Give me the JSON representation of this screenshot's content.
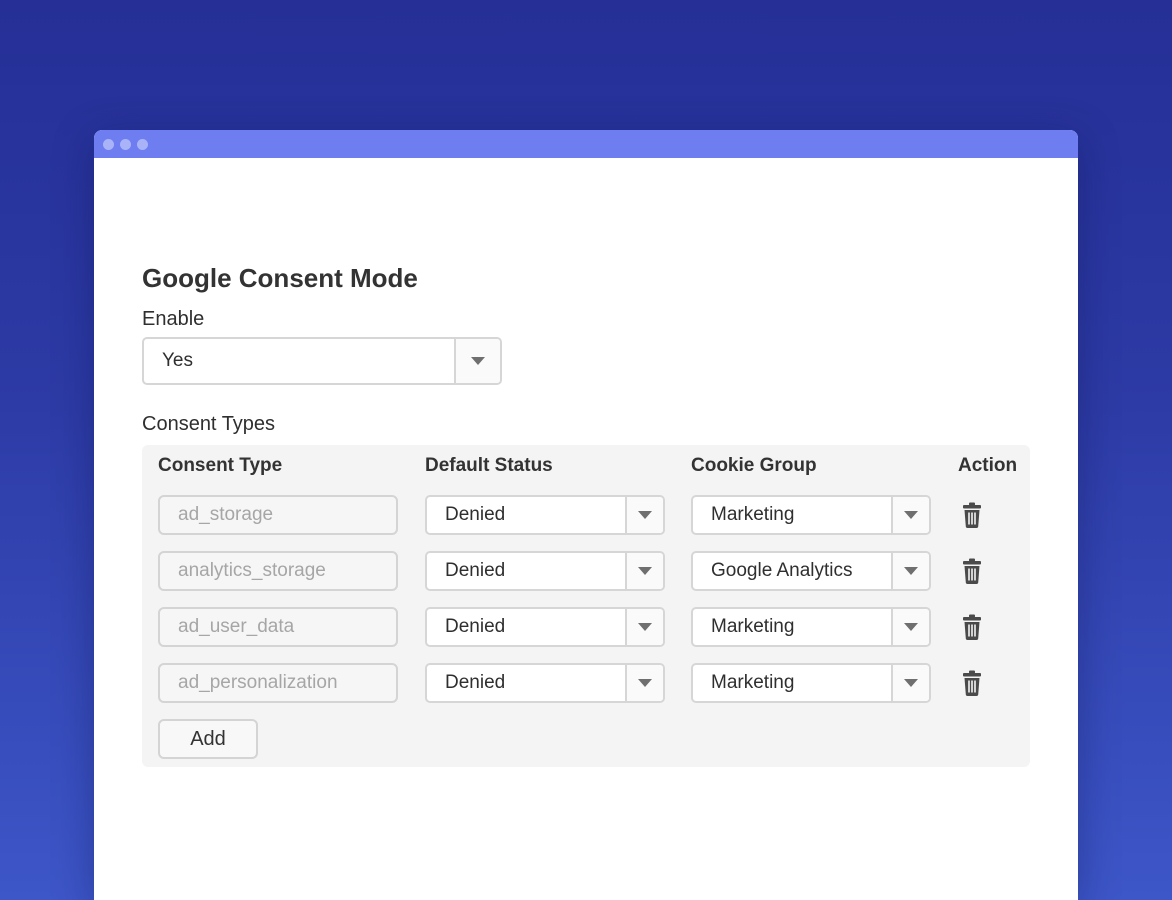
{
  "colors": {
    "background_top": "#252f96",
    "background_bottom": "#3d56c8",
    "titlebar": "#6e7ef0",
    "panel": "#f4f4f4"
  },
  "window": {
    "controls": [
      "dot",
      "dot",
      "dot"
    ]
  },
  "main": {
    "title": "Google Consent Mode",
    "enable": {
      "label": "Enable",
      "value": "Yes"
    },
    "consent_types": {
      "label": "Consent Types",
      "headers": {
        "consent_type": "Consent Type",
        "default_status": "Default Status",
        "cookie_group": "Cookie Group",
        "action": "Action"
      },
      "rows": [
        {
          "consent_type": "ad_storage",
          "default_status": "Denied",
          "cookie_group": "Marketing",
          "action_icon": "trash-icon"
        },
        {
          "consent_type": "analytics_storage",
          "default_status": "Denied",
          "cookie_group": "Google Analytics",
          "action_icon": "trash-icon"
        },
        {
          "consent_type": "ad_user_data",
          "default_status": "Denied",
          "cookie_group": "Marketing",
          "action_icon": "trash-icon"
        },
        {
          "consent_type": "ad_personalization",
          "default_status": "Denied",
          "cookie_group": "Marketing",
          "action_icon": "trash-icon"
        }
      ],
      "add_label": "Add"
    }
  }
}
